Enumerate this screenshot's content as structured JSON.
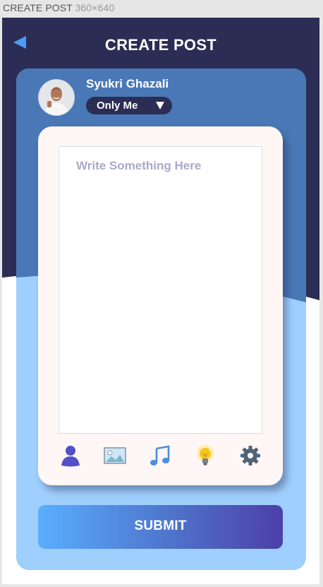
{
  "frame": {
    "name": "CREATE POST",
    "size": "360×640"
  },
  "header": {
    "title": "CREATE POST"
  },
  "user": {
    "name": "Syukri Ghazali"
  },
  "privacy": {
    "selected": "Only Me"
  },
  "composer": {
    "placeholder": "Write Something Here"
  },
  "toolbar": {
    "icons": [
      "person-icon",
      "image-icon",
      "music-icon",
      "lightbulb-icon",
      "settings-icon"
    ]
  },
  "submit": {
    "label": "SUBMIT"
  },
  "colors": {
    "header_bg": "#2c2d54",
    "card_top": "#4a78b7",
    "card_bottom": "#9fcffd",
    "compose_bg": "#fff6f6",
    "accent": "#5aaeff"
  }
}
